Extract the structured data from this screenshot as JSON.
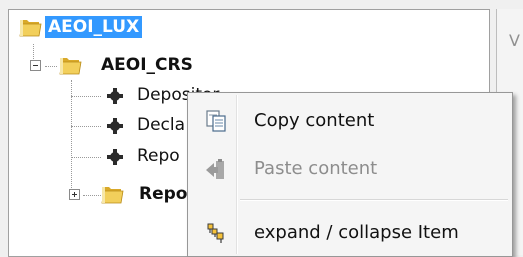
{
  "tree": {
    "root": {
      "label": "AEOI_LUX",
      "icon": "folder-icon"
    },
    "child": {
      "label": "AEOI_CRS",
      "icon": "folder-icon"
    },
    "leaves": [
      {
        "label": "Depositor",
        "icon": "gear-icon"
      },
      {
        "label": "Decla",
        "icon": "gear-icon"
      },
      {
        "label": "Repo",
        "icon": "gear-icon"
      }
    ],
    "collapsed": {
      "label": "Repo",
      "icon": "folder-icon"
    }
  },
  "right_panel": {
    "letter": "V"
  },
  "context_menu": {
    "items": [
      {
        "label": "Copy content",
        "icon": "copy-icon",
        "enabled": true
      },
      {
        "label": "Paste content",
        "icon": "paste-icon",
        "enabled": false
      },
      {
        "label": "expand / collapse Item",
        "icon": "expand-collapse-icon",
        "enabled": true
      }
    ]
  },
  "colors": {
    "selection": "#3399ff",
    "folder": "#e8c34a",
    "disabled_text": "#8d8d8d"
  }
}
